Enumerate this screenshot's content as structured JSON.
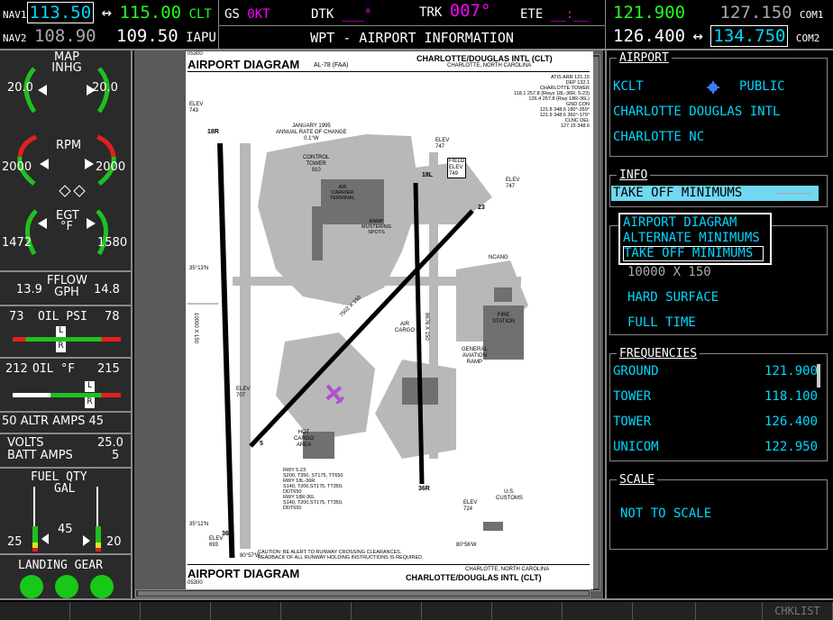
{
  "top": {
    "nav1_label": "NAV1",
    "nav1_active": "113.50",
    "nav1_arrow": "↔",
    "nav1_standby": "115.00",
    "nav1_id": "CLT",
    "nav2_label": "NAV2",
    "nav2_active": "108.90",
    "nav2_standby": "109.50",
    "nav2_id": "IAPU",
    "gs_label": "GS",
    "gs_value": "0KT",
    "dtk_label": "DTK",
    "dtk_value": "___°",
    "trk_label": "TRK",
    "trk_value": "007°",
    "ete_label": "ETE",
    "ete_value": "__:__",
    "page_title": "WPT - AIRPORT INFORMATION",
    "com1_active": "121.900",
    "com1_standby": "127.150",
    "com1_label": "COM1",
    "com2_active": "126.400",
    "com2_arrow": "↔",
    "com2_standby": "134.750",
    "com2_label": "COM2"
  },
  "eis": {
    "map_label": "MAP",
    "inhg_label": "INHG",
    "map_left": "20.0",
    "map_right": "20.0",
    "rpm_label": "RPM",
    "rpm_left": "2000",
    "rpm_right": "2000",
    "egt_label": "EGT",
    "egt_unit": "°F",
    "egt_left": "1472",
    "egt_right": "1580",
    "fflow_label": "FFLOW",
    "fflow_unit": "GPH",
    "fflow_left": "13.9",
    "fflow_right": "14.8",
    "oilpsi_label": "OIL PSI",
    "oilpsi_left": "73",
    "oilpsi_right": "78",
    "oilf_label": "OIL °F",
    "oilf_left": "212",
    "oilf_right": "215",
    "altr_left": "50",
    "altr_label": "ALTR AMPS",
    "altr_right": "45",
    "volts_label": "VOLTS",
    "volts_value": "25.0",
    "batt_label": "BATT AMPS",
    "batt_value": "5",
    "fuel_label": "FUEL QTY",
    "fuel_unit": "GAL",
    "fuel_mid": "45",
    "fuel_left": "25",
    "fuel_right": "20",
    "gear_label": "LANDING GEAR",
    "marker_l": "L",
    "marker_r": "R"
  },
  "chart": {
    "header_title": "AIRPORT DIAGRAM",
    "header_code": "AL-78 (FAA)",
    "header_airport": "CHARLOTTE/DOUGLAS INTL (CLT)",
    "header_city": "CHARLOTTE, NORTH CAROLINA",
    "code_top": "05300",
    "freq_block": [
      "ATIS ARR 121.15",
      "DEP 132.1",
      "CHARLOTTE TOWER",
      "118.1 257.8 (Rwys 18L-36R, 5-23)",
      "126.4 257.8 (Rwy 18R-36L)",
      "GND CON",
      "121.8 348.6 180°-359°",
      "121.9 348.6 360°-179°",
      "CLNC DEL",
      "127.15 348.6"
    ],
    "variation": [
      "JANUARY 1995",
      "ANNUAL RATE OF CHANGE",
      "0.1°W"
    ],
    "tower": [
      "CONTROL",
      "TOWER",
      "910"
    ],
    "terminal": [
      "AIR",
      "CARRIER",
      "TERMINAL"
    ],
    "ramp": [
      "RAMP",
      "MUSTERING",
      "SPOTS"
    ],
    "field_elev": [
      "FIELD",
      "ELEV",
      "749"
    ],
    "elev_743": [
      "ELEV",
      "743"
    ],
    "elev_747": [
      "ELEV",
      "747"
    ],
    "elev_747b": [
      "ELEV",
      "747"
    ],
    "elev_707": [
      "ELEV",
      "707"
    ],
    "elev_724": [
      "ELEV",
      "724"
    ],
    "elev_693": [
      "ELEV",
      "693"
    ],
    "lat1": "35°13'N",
    "lat2": "35°12'N",
    "lon1": "80°57'W",
    "lon2": "80°56'W",
    "ncang": "NCANG",
    "fire": [
      "FIRE",
      "STATION"
    ],
    "cargo": [
      "AIR",
      "CARGO"
    ],
    "ga": [
      "GENERAL",
      "AVIATION",
      "RAMP"
    ],
    "hot_cargo": [
      "HOT",
      "CARGO",
      "AREA"
    ],
    "customs": [
      "U.S.",
      "CUSTOMS"
    ],
    "rwy_left": "10000 X 150",
    "rwy_diag": "7502 X 150",
    "rwy_right": "8676 X 150",
    "rwy_labels": [
      "18R",
      "36L",
      "18L",
      "36R",
      "5",
      "23"
    ],
    "strength": [
      "RWY 5-23",
      "S200, T350, ST175, TT650",
      "RWY 18L-36R",
      "S140, T200,ST175, TT350,",
      "DDT650",
      "RWY 18R-36L",
      "S140, T200,ST175, TT350,",
      "DDT650"
    ],
    "caution": [
      "CAUTION: BE ALERT TO RUNWAY CROSSING CLEARANCES.",
      "READBACK OF ALL RUNWAY HOLDING INSTRUCTIONS IS REQUIRED."
    ],
    "footer_title": "AIRPORT DIAGRAM",
    "footer_city": "CHARLOTTE, NORTH CAROLINA",
    "footer_airport": "CHARLOTTE/DOUGLAS INTL (CLT)",
    "code_bottom": "05300"
  },
  "right": {
    "airport_title": "AIRPORT",
    "ident": "KCLT",
    "type": "PUBLIC",
    "name": "CHARLOTTE DOUGLAS INTL",
    "city": "CHARLOTTE NC",
    "info_title": "INFO",
    "info_selected": "TAKE OFF MINIMUMS",
    "menu_items": [
      "AIRPORT DIAGRAM",
      "ALTERNATE MINIMUMS",
      "TAKE OFF MINIMUMS"
    ],
    "runway_line": "10000 X 150",
    "surface": "HARD SURFACE",
    "lighting": "FULL TIME",
    "freq_title": "FREQUENCIES",
    "freqs": [
      {
        "name": "GROUND",
        "value": "121.900"
      },
      {
        "name": "TOWER",
        "value": "118.100"
      },
      {
        "name": "TOWER",
        "value": "126.400"
      },
      {
        "name": "UNICOM",
        "value": "122.950"
      }
    ],
    "scale_title": "SCALE",
    "scale_value": "NOT TO SCALE"
  },
  "softkeys": {
    "last": "CHKLIST"
  }
}
